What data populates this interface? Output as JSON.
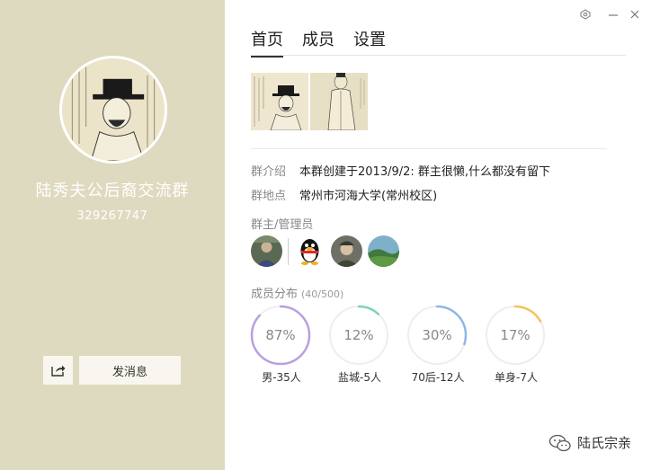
{
  "group": {
    "name": "陆秀夫公后裔交流群",
    "id": "329267747"
  },
  "left_panel": {
    "send_message_label": "发消息"
  },
  "tabs": [
    {
      "label": "首页",
      "active": true
    },
    {
      "label": "成员",
      "active": false
    },
    {
      "label": "设置",
      "active": false
    }
  ],
  "info": {
    "intro_label": "群介绍",
    "intro_value": "本群创建于2013/9/2:  群主很懒,什么都没有留下",
    "location_label": "群地点",
    "location_value": "常州市河海大学(常州校区)"
  },
  "admins": {
    "title": "群主/管理员",
    "count": 4
  },
  "distribution": {
    "title": "成员分布",
    "count_text": "(40/500)",
    "stats": [
      {
        "percent_text": "87%",
        "percent": 87,
        "label": "男-35人",
        "color": "#b9a0df"
      },
      {
        "percent_text": "12%",
        "percent": 12,
        "label": "盐城-5人",
        "color": "#7fd3b4"
      },
      {
        "percent_text": "30%",
        "percent": 30,
        "label": "70后-12人",
        "color": "#8fb7e6"
      },
      {
        "percent_text": "17%",
        "percent": 17,
        "label": "单身-7人",
        "color": "#f2c35a"
      }
    ]
  },
  "watermark": {
    "text": "陆氏宗亲"
  },
  "icons": {
    "share": "share-icon",
    "settings": "window-settings-icon",
    "minimize": "minimize-icon",
    "close": "close-icon",
    "wechat": "wechat-icon"
  }
}
